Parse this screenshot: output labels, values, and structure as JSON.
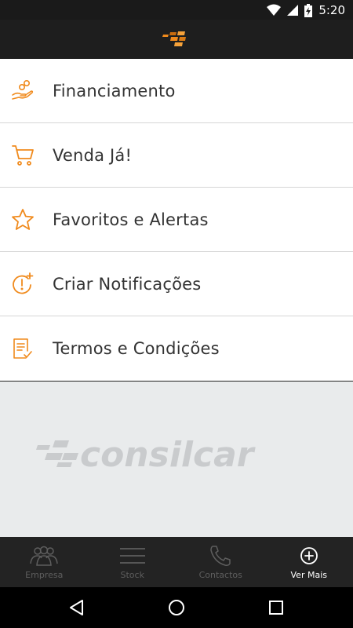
{
  "status_bar": {
    "time": "5:20",
    "icons": [
      "wifi-icon",
      "signal-icon",
      "battery-charging-icon"
    ]
  },
  "app_bar": {
    "logo": "consilcar-flag-logo"
  },
  "menu": {
    "items": [
      {
        "label": "Financiamento",
        "icon": "hand-coins-icon"
      },
      {
        "label": "Venda Já!",
        "icon": "cart-icon"
      },
      {
        "label": "Favoritos e Alertas",
        "icon": "star-icon"
      },
      {
        "label": "Criar Notificações",
        "icon": "alert-clock-icon"
      },
      {
        "label": "Termos e Condições",
        "icon": "document-check-icon"
      }
    ]
  },
  "brand": {
    "watermark_text": "consilcar"
  },
  "tab_bar": {
    "tabs": [
      {
        "label": "Empresa",
        "icon": "people-icon",
        "active": false
      },
      {
        "label": "Stock",
        "icon": "menu-lines-icon",
        "active": false
      },
      {
        "label": "Contactos",
        "icon": "phone-icon",
        "active": false
      },
      {
        "label": "Ver Mais",
        "icon": "plus-circle-icon",
        "active": true
      }
    ]
  },
  "nav_bar": {
    "buttons": [
      "back-icon",
      "home-icon",
      "recents-icon"
    ]
  },
  "colors": {
    "accent": "#f08a1c",
    "dark_bar": "#1e1e1e",
    "tab_inactive": "#5e5e5e",
    "brand_bg": "#e9ebec"
  }
}
